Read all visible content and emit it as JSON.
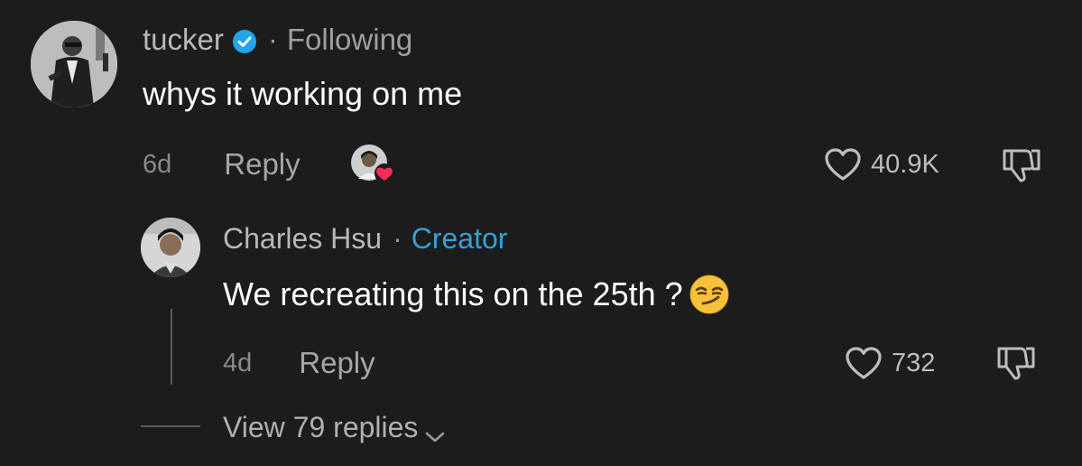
{
  "comment": {
    "username": "tucker",
    "separator": "·",
    "follow_status": "Following",
    "text": "whys it working on me",
    "time": "6d",
    "reply_label": "Reply",
    "like_count": "40.9K"
  },
  "reply": {
    "username": "Charles Hsu",
    "separator": "·",
    "role_badge": "Creator",
    "text": "We recreating this on the 25th ?",
    "emoji_icon": "smirking-face-emoji",
    "time": "4d",
    "reply_label": "Reply",
    "like_count": "732"
  },
  "thread": {
    "view_replies_label": "View 79 replies"
  },
  "colors": {
    "background": "#1c1c1c",
    "primary_text": "#ffffff",
    "secondary_text": "#9f9f9f",
    "creator_accent": "#3a9fd4",
    "verified_badge": "#20a5f0",
    "creator_heart": "#fe2c55"
  },
  "icons": {
    "verified": "verified-badge-icon",
    "like": "heart-outline-icon",
    "dislike": "thumbs-down-icon",
    "creator_liked": "creator-liked-heart-icon",
    "expand": "chevron-down-icon"
  }
}
